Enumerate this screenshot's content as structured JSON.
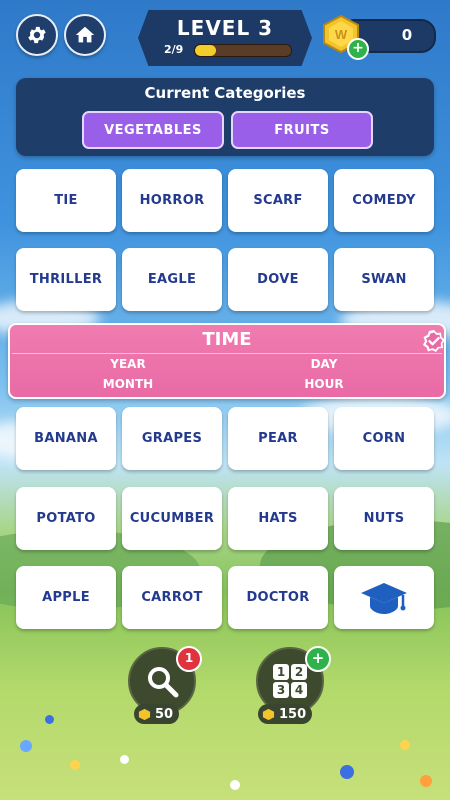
{
  "header": {
    "level_title": "LEVEL 3",
    "progress_label": "2/9",
    "progress_fraction": 0.22,
    "coins": "0"
  },
  "categories": {
    "title": "Current Categories",
    "items": [
      "VEGETABLES",
      "FRUITS"
    ]
  },
  "grid": {
    "rows": [
      [
        "TIE",
        "HORROR",
        "SCARF",
        "COMEDY"
      ],
      [
        "THRILLER",
        "EAGLE",
        "DOVE",
        "SWAN"
      ],
      [
        "BANANA",
        "GRAPES",
        "PEAR",
        "CORN"
      ],
      [
        "POTATO",
        "CUCUMBER",
        "HATS",
        "NUTS"
      ],
      [
        "APPLE",
        "CARROT",
        "DOCTOR",
        ""
      ]
    ],
    "special_tile_icon": "graduation-cap-icon"
  },
  "solved_group": {
    "title": "TIME",
    "words": [
      "YEAR",
      "DAY",
      "MONTH",
      "HOUR"
    ]
  },
  "boosters": [
    {
      "name": "hint",
      "icon": "magnifier-icon",
      "cost": "50",
      "badge": "1"
    },
    {
      "name": "reveal",
      "icon": "number-grid-icon",
      "cost": "150",
      "badge": "+",
      "digits": [
        "1",
        "2",
        "3",
        "4"
      ]
    }
  ],
  "colors": {
    "panel": "#1e3d68",
    "chip": "#9a5fe8",
    "tile_text": "#233a8e",
    "solved": "#e96aa5"
  }
}
